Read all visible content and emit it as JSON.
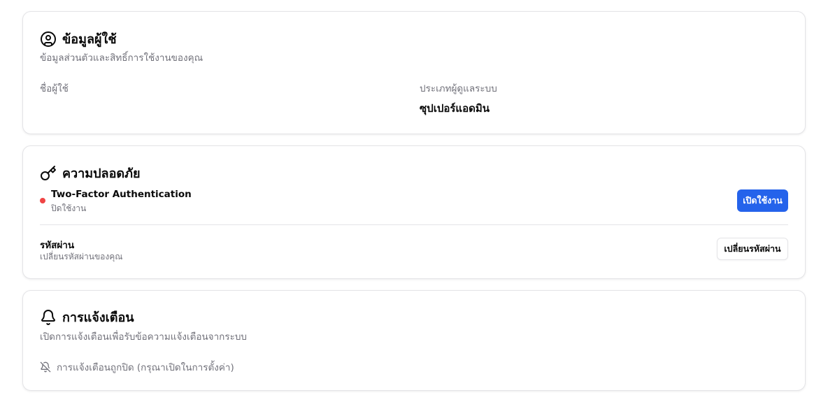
{
  "profile": {
    "title": "ข้อมูลผู้ใช้",
    "icon": "user-circle-icon",
    "description": "ข้อมูลส่วนตัวและสิทธิ์การใช้งานของคุณ",
    "fields": [
      {
        "label": "ชื่อผู้ใช้",
        "value": ""
      },
      {
        "label": "ประเภทผู้ดูแลระบบ",
        "value": "ซุปเปอร์แอดมิน"
      }
    ]
  },
  "security": {
    "title": "ความปลอดภัย",
    "icon": "key-icon",
    "two_factor": {
      "title": "Two-Factor Authentication",
      "status": "ปิดใช้งาน",
      "status_color": "#ef4444",
      "button_label": "เปิดใช้งาน"
    },
    "password": {
      "title": "รหัสผ่าน",
      "description": "เปลี่ยนรหัสผ่านของคุณ",
      "button_label": "เปลี่ยนรหัสผ่าน"
    }
  },
  "notifications": {
    "title": "การแจ้งเตือน",
    "icon": "bell-icon",
    "description": "เปิดการแจ้งเตือนเพื่อรับข้อความแจ้งเตือนจากระบบ",
    "status_icon": "bell-off-icon",
    "status_text": "การแจ้งเตือนถูกปิด (กรุณาเปิดในการตั้งค่า)"
  },
  "colors": {
    "primary": "#2563eb",
    "border": "#e4e4e7",
    "muted_text": "#71717a",
    "danger": "#ef4444"
  }
}
